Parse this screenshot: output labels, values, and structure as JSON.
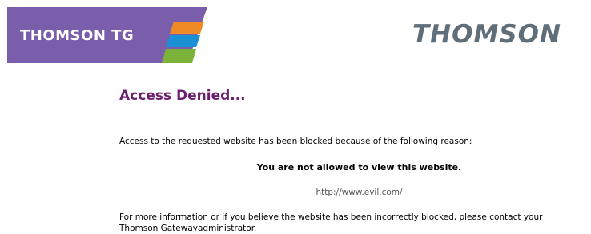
{
  "header": {
    "banner_text": "THOMSON TG",
    "brand": "THOMSON"
  },
  "colors": {
    "banner_purple": "#7b5eab",
    "stripe_orange": "#f08a24",
    "stripe_blue": "#1a8fd4",
    "stripe_green": "#7ab23a",
    "heading_purple": "#6b1f6e",
    "brand_gray": "#5f6e78"
  },
  "main": {
    "heading": "Access Denied...",
    "intro": "Access to the requested website has been blocked because of the following reason:",
    "reason": "You are not allowed to view this website.",
    "blocked_url": "http://www.evil.com/",
    "more_info_line1": "For more information or if you believe the website has been incorrectly blocked, please contact your",
    "more_info_line2": "Thomson Gatewayadministrator."
  }
}
